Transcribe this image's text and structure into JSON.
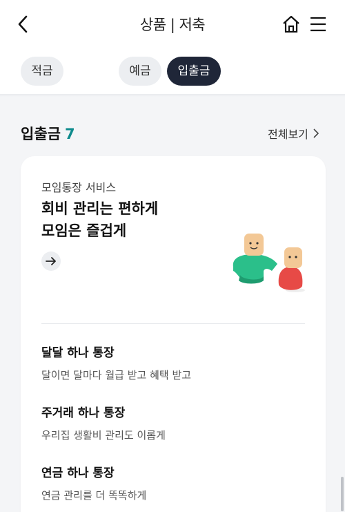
{
  "header": {
    "title": "상품 | 저축",
    "back_icon": "chevron-left-icon",
    "home_icon": "home-icon",
    "menu_icon": "hamburger-menu-icon"
  },
  "filters": [
    {
      "label": "적금",
      "selected": false
    },
    {
      "label": "예금",
      "selected": false
    },
    {
      "label": "입출금",
      "selected": true
    }
  ],
  "section": {
    "title": "입출금",
    "count": "7",
    "view_all": "전체보기"
  },
  "promo": {
    "subtitle": "모임통장 서비스",
    "title_line1": "회비 관리는 편하게",
    "title_line2": "모임은 즐겁게"
  },
  "products": [
    {
      "name": "달달 하나 통장",
      "desc": "달이면 달마다 월급 받고 혜택 받고"
    },
    {
      "name": "주거래 하나 통장",
      "desc": "우리집 생활비 관리도 이롭게"
    },
    {
      "name": "연금 하나 통장",
      "desc": "연금 관리를 더 똑똑하게"
    }
  ],
  "colors": {
    "accent_teal": "#0e8b8d",
    "selected_chip": "#1f2638",
    "chip_bg": "#eceef1",
    "page_bg": "#f4f5f7"
  }
}
